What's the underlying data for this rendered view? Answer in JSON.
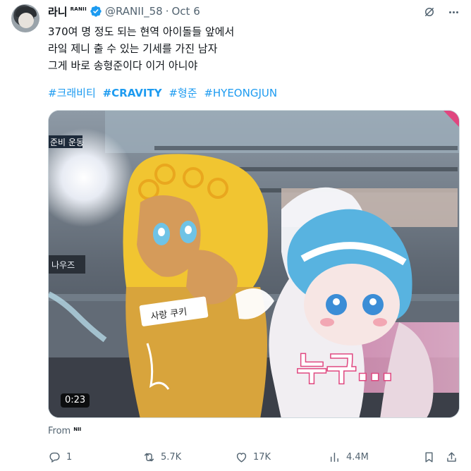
{
  "tweet": {
    "display_name": "라니",
    "name_badge": "RANII",
    "handle": "@RANII_58",
    "separator": "·",
    "date": "Oct 6",
    "lines": [
      "370여 명 정도 되는 현역 아이돌들 앞에서",
      "라잌 제니 출 수 있는 기세를 가진 남자",
      "그게 바로 송형준이다 이거 아니야"
    ],
    "hashtags": [
      "#크래비티",
      "#CRAVITY",
      "#형준",
      "#HYEONGJUN"
    ]
  },
  "media": {
    "duration": "0:23",
    "overlay_tag_left": "준비 운동",
    "sign_left": "나우즈",
    "costume_label": "사랑 쿠키",
    "caption": "누구..."
  },
  "source": {
    "label": "From",
    "app": "NII"
  },
  "actions": {
    "replies": "1",
    "reposts": "5.7K",
    "likes": "17K",
    "views": "4.4M"
  },
  "colors": {
    "accent": "#1d9bf0",
    "text_secondary": "#536471"
  },
  "icons": [
    "verified-icon",
    "grok-icon",
    "more-icon",
    "reply-icon",
    "repost-icon",
    "like-icon",
    "views-icon",
    "bookmark-icon",
    "share-icon"
  ]
}
